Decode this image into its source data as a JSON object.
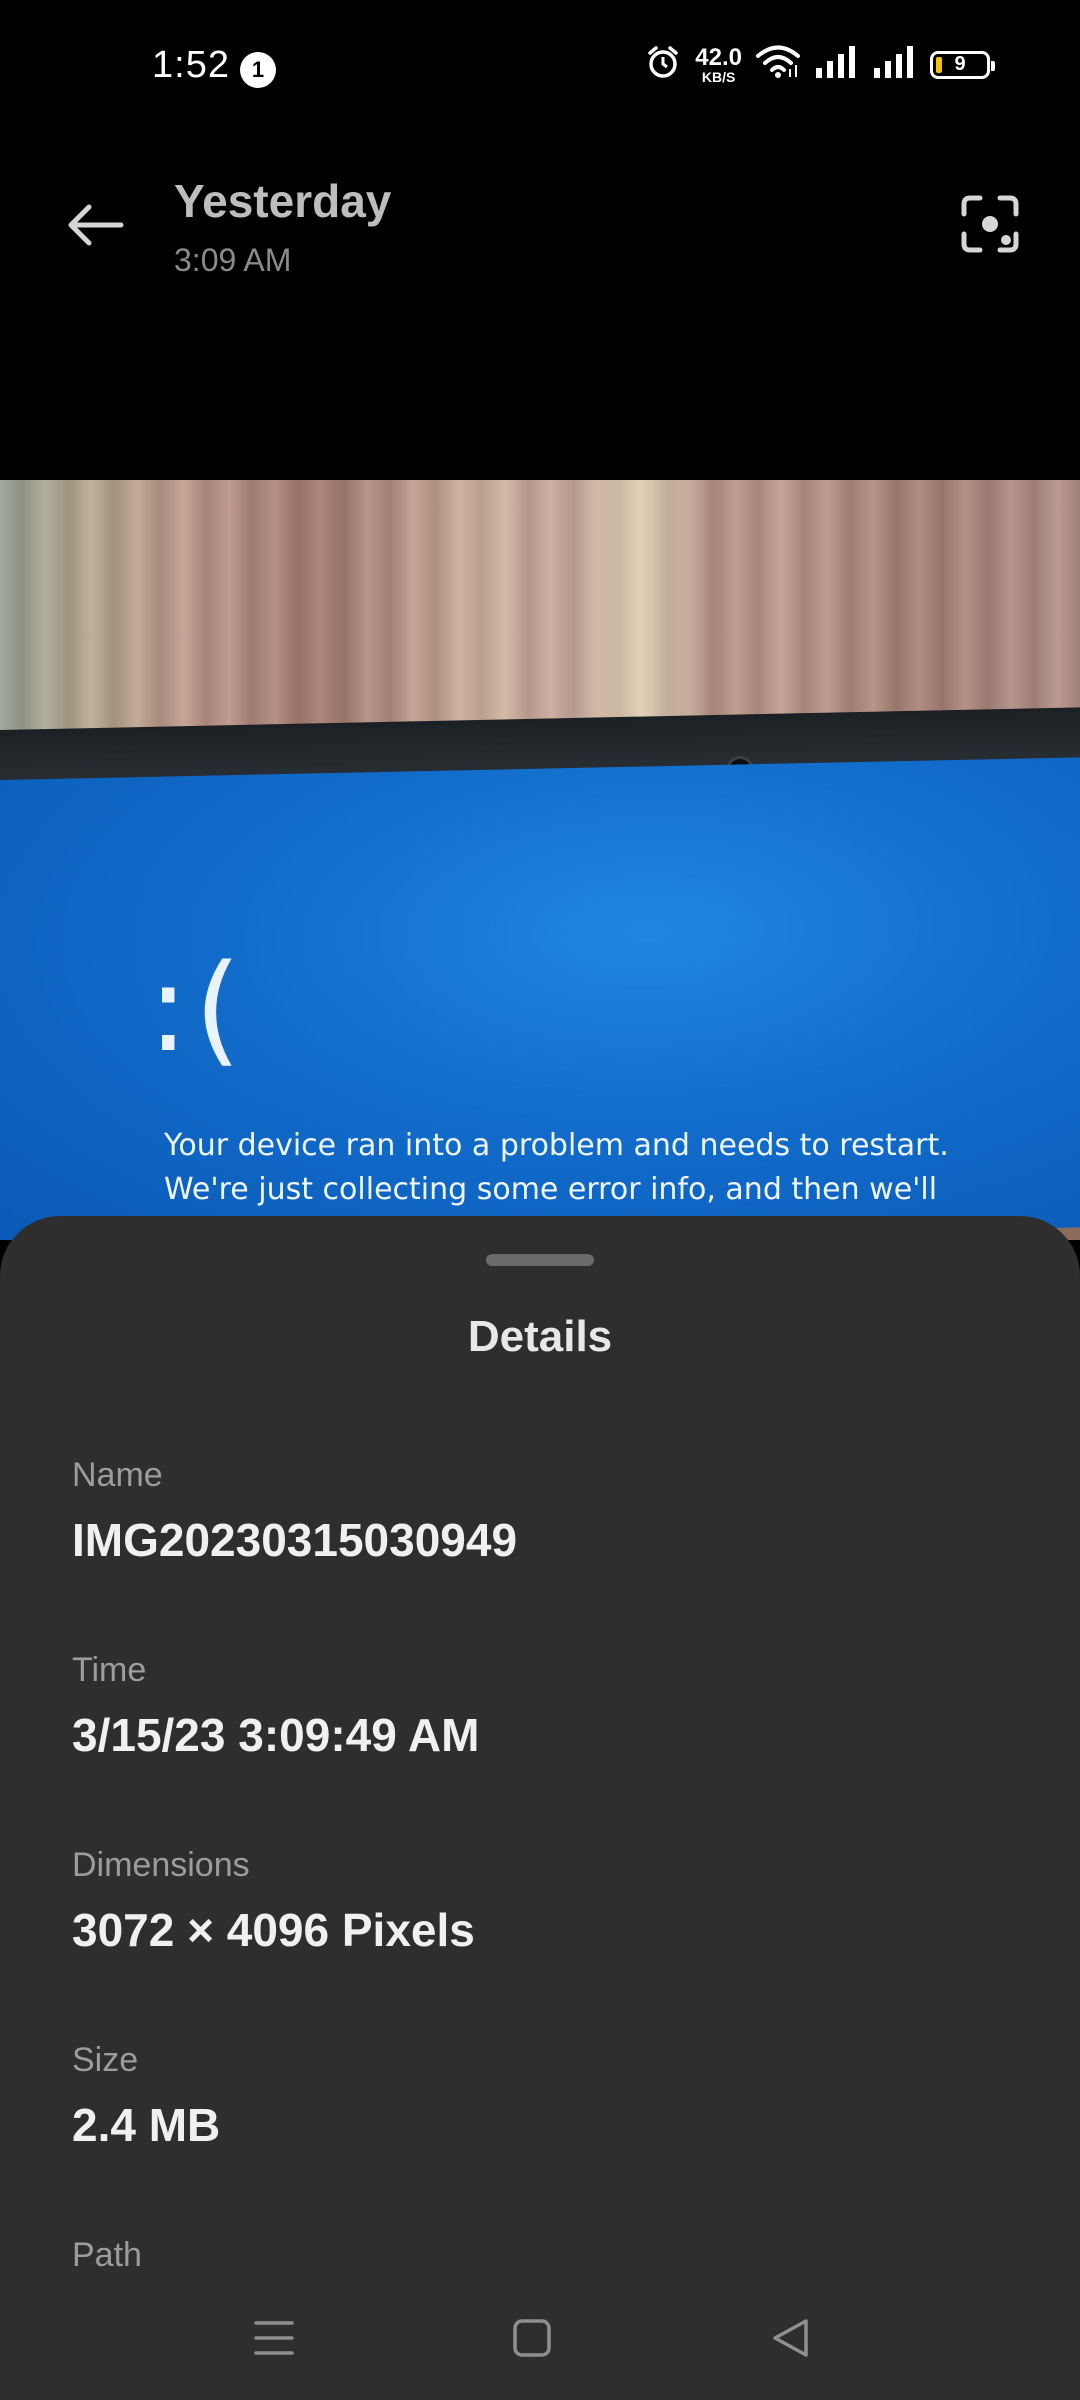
{
  "status_bar": {
    "time": "1:52",
    "notification_count": "1",
    "network_speed_value": "42.0",
    "network_speed_unit": "KB/S",
    "battery_level": "9"
  },
  "header": {
    "title": "Yesterday",
    "subtitle": "3:09 AM"
  },
  "photo": {
    "bsod_face": ":(",
    "bsod_line1": "Your device ran into a problem and needs to restart.",
    "bsod_line2": "We're just collecting some error info, and then we'll"
  },
  "sheet": {
    "title": "Details",
    "details": [
      {
        "label": "Name",
        "value": "IMG20230315030949"
      },
      {
        "label": "Time",
        "value": "3/15/23 3:09:49 AM"
      },
      {
        "label": "Dimensions",
        "value": "3072 × 4096 Pixels"
      },
      {
        "label": "Size",
        "value": "2.4 MB"
      },
      {
        "label": "Path",
        "value": ""
      }
    ]
  },
  "icons": {
    "back": "arrow-left-icon",
    "lens": "lens-scan-icon",
    "alarm": "alarm-icon",
    "wifi": "wifi-icon",
    "signal": "signal-icon",
    "nav_menu": "menu-icon",
    "nav_home": "home-icon",
    "nav_back": "back-triangle-icon"
  },
  "colors": {
    "sheet_background": "#2e2e2e",
    "battery_fill": "#f5c400"
  }
}
